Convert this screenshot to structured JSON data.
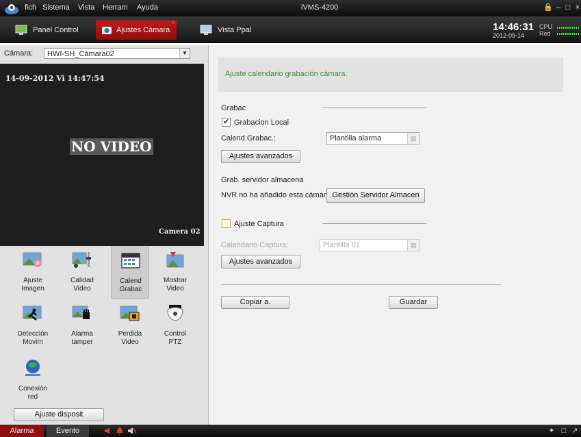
{
  "titlebar": {
    "menu": [
      "fich",
      "Sistema",
      "Vista",
      "Herram",
      "Ayuda"
    ],
    "app_title": "iVMS-4200"
  },
  "tabs": [
    {
      "label": "Panel Control"
    },
    {
      "label": "Ajustes Cámara"
    },
    {
      "label": "Vista Ppal"
    }
  ],
  "status": {
    "time": "14:46:31",
    "date": "2012-09-14",
    "cpu_label": "CPU",
    "net_label": "Red"
  },
  "camera": {
    "label": "Cámara:",
    "selected": "HWI-SH_Cámara02"
  },
  "video": {
    "timestamp": "14-09-2012 Vi 14:47:54",
    "no_video": "NO VIDEO",
    "camera_name": "Camera 02"
  },
  "tools": [
    {
      "l1": "Ajuste",
      "l2": "Imagen",
      "icon": "image-settings-icon"
    },
    {
      "l1": "Calidad",
      "l2": "Video",
      "icon": "video-quality-icon"
    },
    {
      "l1": "Calend",
      "l2": "Grabac",
      "icon": "calendar-icon"
    },
    {
      "l1": "Mostrar",
      "l2": "Video",
      "icon": "show-video-icon"
    },
    {
      "l1": "Detección",
      "l2": "Movim",
      "icon": "motion-detection-icon"
    },
    {
      "l1": "Alarma",
      "l2": "tamper",
      "icon": "tamper-alarm-icon"
    },
    {
      "l1": "Perdida",
      "l2": "Video",
      "icon": "video-loss-icon"
    },
    {
      "l1": "Control",
      "l2": "PTZ",
      "icon": "ptz-camera-icon"
    },
    {
      "l1": "Conexión",
      "l2": "red",
      "icon": "network-icon"
    }
  ],
  "device_settings_button": "Ajuste disposit",
  "main": {
    "banner": "Ajuste calendario grabación cámara.",
    "recording_section": "Grabac",
    "local_recording": "Grabacion Local",
    "local_recording_checked": true,
    "schedule_label": "Calend.Grabac.:",
    "schedule_value": "Plantilla alarma",
    "advanced_button": "Ajustes avanzados",
    "storage_server_section": "Grab. servidor almacena",
    "nvr_message": "NVR no ha añadido esta cámara",
    "storage_server_button": "Gestión Servidor Almacen",
    "capture_section": "Ajuste Captura",
    "capture_checked": false,
    "capture_schedule_label": "Calendario Captura:",
    "capture_schedule_value": "Plantilla 01",
    "capture_advanced_button": "Ajustes avanzados",
    "copy_button": "Copiar a.",
    "save_button": "Guardar"
  },
  "statusbar": {
    "tabs": [
      "Alarma",
      "Evento"
    ]
  },
  "colors": {
    "active_tab": "#b01414",
    "banner_text": "#3c8a3c",
    "title_bar": "#1a1a1a"
  }
}
